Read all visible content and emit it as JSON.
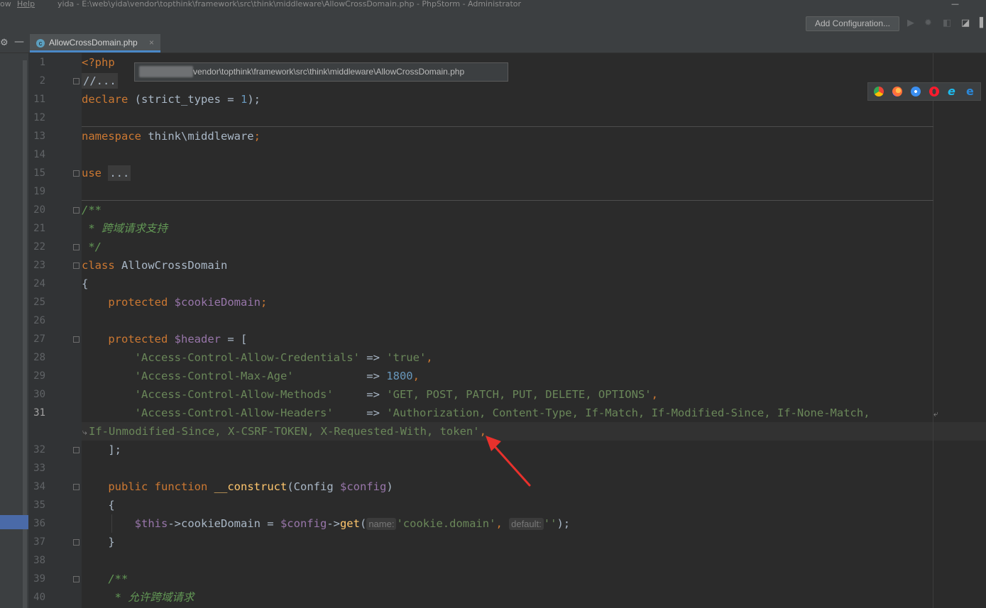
{
  "titlebar": {
    "menu": [
      "ow",
      "Help"
    ],
    "title": "yida - E:\\web\\yida\\vendor\\topthink\\framework\\src\\think\\middleware\\AllowCrossDomain.php - PhpStorm - Administrator",
    "minimize": "—"
  },
  "toolbar": {
    "add_configuration": "Add Configuration...",
    "icons": [
      "run-icon",
      "debug-icon",
      "coverage-icon",
      "profile-icon"
    ]
  },
  "tabs": [
    {
      "label": "AllowCrossDomain.php",
      "icon": "php-class-icon",
      "close": "×",
      "active": true
    }
  ],
  "tooltip": {
    "path": "vendor\\topthink\\framework\\src\\think\\middleware\\AllowCrossDomain.php"
  },
  "browsers": [
    {
      "name": "chrome",
      "color": "#e8453c"
    },
    {
      "name": "firefox",
      "color": "#ff7139"
    },
    {
      "name": "safari",
      "color": "#3b8ff0"
    },
    {
      "name": "opera",
      "color": "#ff1b2d"
    },
    {
      "name": "ie",
      "color": "#1ebbee"
    },
    {
      "name": "edge",
      "color": "#0078d7"
    }
  ],
  "editor": {
    "current_line": "31",
    "line_numbers": [
      "1",
      "2",
      "11",
      "12",
      "13",
      "14",
      "15",
      "19",
      "20",
      "21",
      "22",
      "23",
      "24",
      "25",
      "26",
      "27",
      "28",
      "29",
      "30",
      "31",
      "",
      "32",
      "33",
      "34",
      "35",
      "36",
      "37",
      "38",
      "39",
      "40"
    ],
    "code": {
      "php_open": "<?php",
      "folded_header": "//...",
      "declare_kw": "declare",
      "declare_mid": " (strict_types = ",
      "declare_num": "1",
      "declare_end": ");",
      "namespace_kw": "namespace",
      "namespace_name": " think\\middleware",
      "namespace_end": ";",
      "use_kw": "use",
      "use_folded": "...",
      "doc_open": "/**",
      "doc_text": " * 跨域请求支持",
      "doc_close": " */",
      "class_kw": "class",
      "class_name": " AllowCrossDomain",
      "brace_open": "{",
      "protected_kw": "protected",
      "cookie_var": "$cookieDomain",
      "semicolon": ";",
      "header_var": "$header",
      "header_assign": " = [",
      "arrow": "=>",
      "comma": ",",
      "h1_key": "'Access-Control-Allow-Credentials'",
      "h1_val": "'true'",
      "h2_key": "'Access-Control-Max-Age'",
      "h2_val": "1800",
      "h3_key": "'Access-Control-Allow-Methods'",
      "h3_val": "'GET, POST, PATCH, PUT, DELETE, OPTIONS'",
      "h4_key": "'Access-Control-Allow-Headers'",
      "h4_val_part1": "'Authorization, Content-Type, If-Match, If-Modified-Since, If-None-Match, ",
      "h4_val_part2": "If-Unmodified-Since, X-CSRF-TOKEN, X-Requested-With, token'",
      "array_close": "];",
      "public_kw": "public",
      "function_kw": "function",
      "construct_name": "__construct",
      "construct_params_open": "(Config ",
      "config_var": "$config",
      "paren_close": ")",
      "method_brace_open": "{",
      "this_var": "$this",
      "this_prop": "->cookieDomain = ",
      "config_var2": "$config",
      "get_arrow": "->",
      "get_fn": "get",
      "paren_open": "(",
      "hint_name": "name:",
      "cookie_str": "'cookie.domain'",
      "comma_sp": ", ",
      "hint_default": "default:",
      "empty_str": "''",
      "call_end": ");",
      "method_brace_close": "}",
      "doc2_open": "/**",
      "doc2_text": " * 允许跨域请求"
    }
  }
}
